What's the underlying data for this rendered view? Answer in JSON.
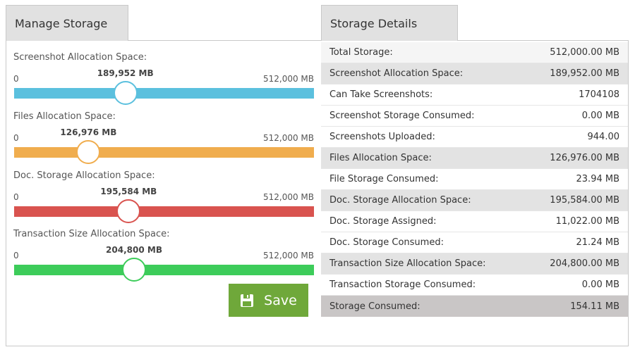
{
  "tabs": {
    "manage": "Manage Storage",
    "details": "Storage Details"
  },
  "sliders": [
    {
      "label": "Screenshot Allocation Space:",
      "min": "0",
      "max": "512,000 MB",
      "value_label": "189,952 MB",
      "fraction": 0.371,
      "color": "#5bc0de"
    },
    {
      "label": "Files Allocation Space:",
      "min": "0",
      "max": "512,000 MB",
      "value_label": "126,976 MB",
      "fraction": 0.248,
      "color": "#f0ad4e"
    },
    {
      "label": "Doc. Storage Allocation Space:",
      "min": "0",
      "max": "512,000 MB",
      "value_label": "195,584 MB",
      "fraction": 0.382,
      "color": "#d9534f"
    },
    {
      "label": "Transaction Size Allocation Space:",
      "min": "0",
      "max": "512,000 MB",
      "value_label": "204,800 MB",
      "fraction": 0.4,
      "color": "#3dcc5a"
    }
  ],
  "save_label": "Save",
  "details": [
    {
      "label": "Total Storage:",
      "value": "512,000.00 MB",
      "style": "total"
    },
    {
      "label": "Screenshot Allocation Space:",
      "value": "189,952.00 MB",
      "style": "hl"
    },
    {
      "label": "Can Take Screenshots:",
      "value": "1704108",
      "style": ""
    },
    {
      "label": "Screenshot Storage Consumed:",
      "value": "0.00 MB",
      "style": ""
    },
    {
      "label": "Screenshots Uploaded:",
      "value": "944.00",
      "style": ""
    },
    {
      "label": "Files Allocation Space:",
      "value": "126,976.00 MB",
      "style": "hl"
    },
    {
      "label": "File Storage Consumed:",
      "value": "23.94 MB",
      "style": ""
    },
    {
      "label": "Doc. Storage Allocation Space:",
      "value": "195,584.00 MB",
      "style": "hl"
    },
    {
      "label": "Doc. Storage Assigned:",
      "value": "11,022.00 MB",
      "style": ""
    },
    {
      "label": "Doc. Storage Consumed:",
      "value": "21.24 MB",
      "style": ""
    },
    {
      "label": "Transaction Size Allocation Space:",
      "value": "204,800.00 MB",
      "style": "hl"
    },
    {
      "label": "Transaction Storage Consumed:",
      "value": "0.00 MB",
      "style": ""
    },
    {
      "label": "Storage Consumed:",
      "value": "154.11 MB",
      "style": "final"
    }
  ]
}
